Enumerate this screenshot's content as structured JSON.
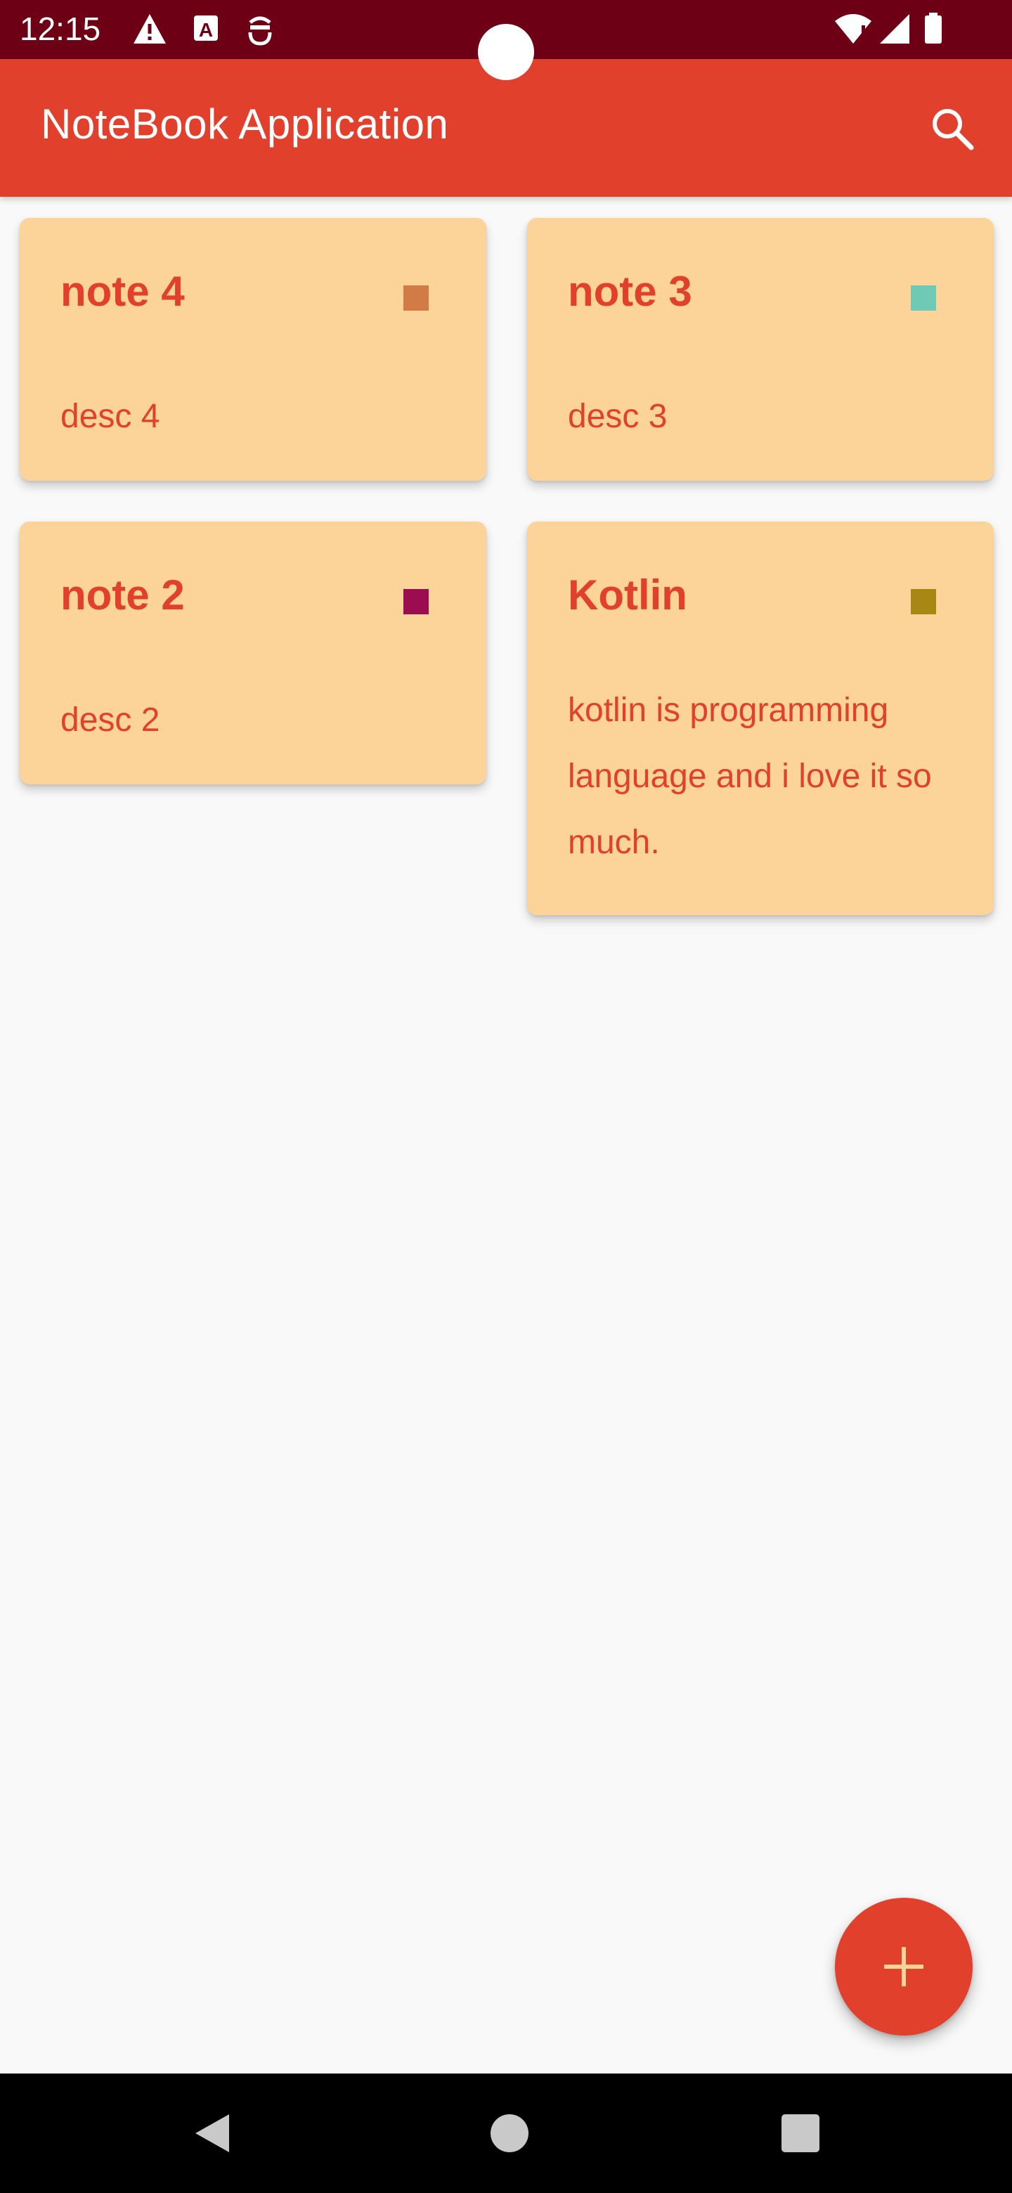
{
  "status_bar": {
    "time": "12:15",
    "icons": [
      "warning-icon",
      "accessibility-a-icon",
      "bug-robot-icon",
      "wifi-alert-icon",
      "signal-icon",
      "battery-icon"
    ]
  },
  "app_bar": {
    "title": "NoteBook Application",
    "search_icon": "search-icon"
  },
  "notes": [
    {
      "title": "note 4",
      "description": "desc 4",
      "color": "#D37B46"
    },
    {
      "title": "note 3",
      "description": "desc 3",
      "color": "#6ECAB5"
    },
    {
      "title": "note 2",
      "description": "desc 2",
      "color": "#9D0C51"
    },
    {
      "title": "Kotlin",
      "description": "kotlin is  programming language and i love it so much.",
      "color": "#A88715"
    }
  ],
  "fab": {
    "icon": "plus-icon"
  },
  "nav_bar": {
    "icons": [
      "back-icon",
      "home-icon",
      "recents-icon"
    ]
  },
  "colors": {
    "status_bar": "#6E0015",
    "primary": "#E1402D",
    "card": "#FCD398",
    "background": "#F9F9F9",
    "fab_icon": "#FCD398"
  }
}
